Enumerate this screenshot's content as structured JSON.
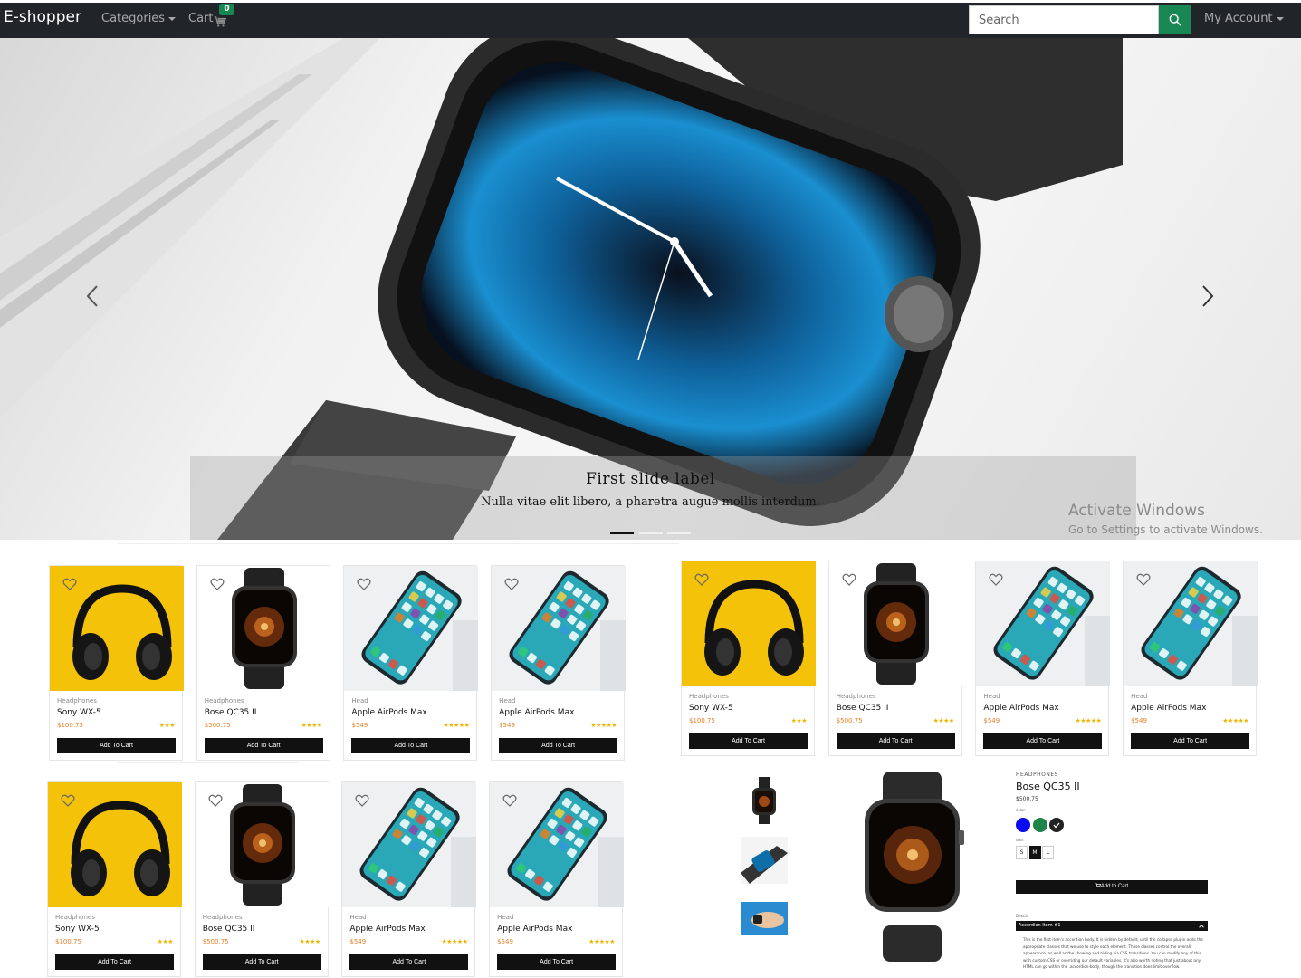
{
  "navbar": {
    "brand": "E-shopper",
    "categories": "Categories",
    "cart": "Cart",
    "cart_count": "0",
    "search_placeholder": "Search",
    "account": "My Account"
  },
  "hero": {
    "title": "First slide label",
    "text": "Nulla vitae elit libero, a pharetra augue mollis interdum.",
    "slides": 3,
    "active_slide": 1
  },
  "watermark": {
    "line1": "Activate Windows",
    "line2": "Go to Settings to activate Windows."
  },
  "add_to_cart": "Add To Cart",
  "products": [
    {
      "category": "Headphones",
      "name": "Sony WX-5",
      "price": "$100.75",
      "rating": 3,
      "image": "headphones"
    },
    {
      "category": "Headphones",
      "name": "Bose QC35 II",
      "price": "$500.75",
      "rating": 4,
      "image": "watch"
    },
    {
      "category": "Head",
      "name": "Apple AirPods Max",
      "price": "$549",
      "rating": 5,
      "image": "phone"
    },
    {
      "category": "Head",
      "name": "Apple AirPods Max",
      "price": "$549",
      "rating": 5,
      "image": "phone"
    }
  ],
  "detail": {
    "category": "HEADPHONES",
    "name": "Bose QC35 II",
    "price": "$500.75",
    "color_label": "color:",
    "colors": [
      "#0a0aee",
      "#1e8449",
      "#222222"
    ],
    "size_label": "size:",
    "sizes": [
      "S",
      "M",
      "L"
    ],
    "selected_size": "M",
    "add_label": "Add to Cart",
    "details_label": "Details",
    "accordion_title": "Accordion Item #1",
    "accordion_body": "This is the first item's accordion body. It is hidden by default, until the collapse plugin adds the appropriate classes that we use to style each element. These classes control the overall appearance, as well as the showing and hiding via CSS transitions. You can modify any of this with custom CSS or overriding our default variables. It's also worth noting that just about any HTML can go within the .accordion-body, though the transition does limit overflow."
  },
  "colors": {
    "navbar": "#212529",
    "accent": "#198754",
    "price": "#e67e22",
    "star": "#f0b400"
  }
}
